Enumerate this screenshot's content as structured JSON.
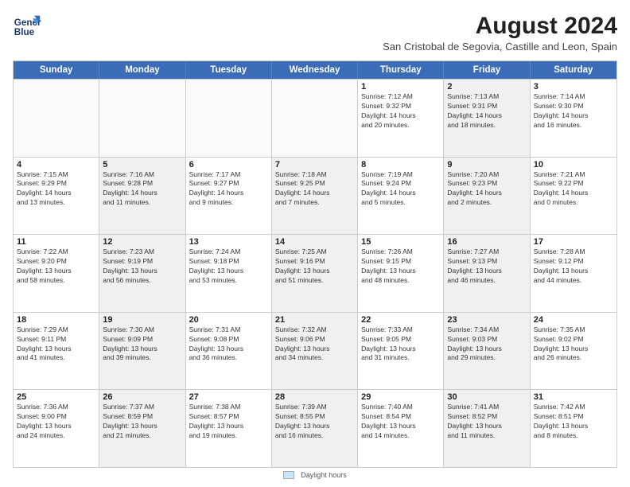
{
  "logo": {
    "line1": "General",
    "line2": "Blue"
  },
  "title": "August 2024",
  "subtitle": "San Cristobal de Segovia, Castille and Leon, Spain",
  "header_days": [
    "Sunday",
    "Monday",
    "Tuesday",
    "Wednesday",
    "Thursday",
    "Friday",
    "Saturday"
  ],
  "footer": {
    "legend_label": "Daylight hours"
  },
  "rows": [
    [
      {
        "num": "",
        "info": "",
        "empty": true
      },
      {
        "num": "",
        "info": "",
        "empty": true
      },
      {
        "num": "",
        "info": "",
        "empty": true
      },
      {
        "num": "",
        "info": "",
        "empty": true
      },
      {
        "num": "1",
        "info": "Sunrise: 7:12 AM\nSunset: 9:32 PM\nDaylight: 14 hours\nand 20 minutes.",
        "empty": false,
        "shaded": false
      },
      {
        "num": "2",
        "info": "Sunrise: 7:13 AM\nSunset: 9:31 PM\nDaylight: 14 hours\nand 18 minutes.",
        "empty": false,
        "shaded": true
      },
      {
        "num": "3",
        "info": "Sunrise: 7:14 AM\nSunset: 9:30 PM\nDaylight: 14 hours\nand 16 minutes.",
        "empty": false,
        "shaded": false
      }
    ],
    [
      {
        "num": "4",
        "info": "Sunrise: 7:15 AM\nSunset: 9:29 PM\nDaylight: 14 hours\nand 13 minutes.",
        "empty": false,
        "shaded": false
      },
      {
        "num": "5",
        "info": "Sunrise: 7:16 AM\nSunset: 9:28 PM\nDaylight: 14 hours\nand 11 minutes.",
        "empty": false,
        "shaded": true
      },
      {
        "num": "6",
        "info": "Sunrise: 7:17 AM\nSunset: 9:27 PM\nDaylight: 14 hours\nand 9 minutes.",
        "empty": false,
        "shaded": false
      },
      {
        "num": "7",
        "info": "Sunrise: 7:18 AM\nSunset: 9:25 PM\nDaylight: 14 hours\nand 7 minutes.",
        "empty": false,
        "shaded": true
      },
      {
        "num": "8",
        "info": "Sunrise: 7:19 AM\nSunset: 9:24 PM\nDaylight: 14 hours\nand 5 minutes.",
        "empty": false,
        "shaded": false
      },
      {
        "num": "9",
        "info": "Sunrise: 7:20 AM\nSunset: 9:23 PM\nDaylight: 14 hours\nand 2 minutes.",
        "empty": false,
        "shaded": true
      },
      {
        "num": "10",
        "info": "Sunrise: 7:21 AM\nSunset: 9:22 PM\nDaylight: 14 hours\nand 0 minutes.",
        "empty": false,
        "shaded": false
      }
    ],
    [
      {
        "num": "11",
        "info": "Sunrise: 7:22 AM\nSunset: 9:20 PM\nDaylight: 13 hours\nand 58 minutes.",
        "empty": false,
        "shaded": false
      },
      {
        "num": "12",
        "info": "Sunrise: 7:23 AM\nSunset: 9:19 PM\nDaylight: 13 hours\nand 56 minutes.",
        "empty": false,
        "shaded": true
      },
      {
        "num": "13",
        "info": "Sunrise: 7:24 AM\nSunset: 9:18 PM\nDaylight: 13 hours\nand 53 minutes.",
        "empty": false,
        "shaded": false
      },
      {
        "num": "14",
        "info": "Sunrise: 7:25 AM\nSunset: 9:16 PM\nDaylight: 13 hours\nand 51 minutes.",
        "empty": false,
        "shaded": true
      },
      {
        "num": "15",
        "info": "Sunrise: 7:26 AM\nSunset: 9:15 PM\nDaylight: 13 hours\nand 48 minutes.",
        "empty": false,
        "shaded": false
      },
      {
        "num": "16",
        "info": "Sunrise: 7:27 AM\nSunset: 9:13 PM\nDaylight: 13 hours\nand 46 minutes.",
        "empty": false,
        "shaded": true
      },
      {
        "num": "17",
        "info": "Sunrise: 7:28 AM\nSunset: 9:12 PM\nDaylight: 13 hours\nand 44 minutes.",
        "empty": false,
        "shaded": false
      }
    ],
    [
      {
        "num": "18",
        "info": "Sunrise: 7:29 AM\nSunset: 9:11 PM\nDaylight: 13 hours\nand 41 minutes.",
        "empty": false,
        "shaded": false
      },
      {
        "num": "19",
        "info": "Sunrise: 7:30 AM\nSunset: 9:09 PM\nDaylight: 13 hours\nand 39 minutes.",
        "empty": false,
        "shaded": true
      },
      {
        "num": "20",
        "info": "Sunrise: 7:31 AM\nSunset: 9:08 PM\nDaylight: 13 hours\nand 36 minutes.",
        "empty": false,
        "shaded": false
      },
      {
        "num": "21",
        "info": "Sunrise: 7:32 AM\nSunset: 9:06 PM\nDaylight: 13 hours\nand 34 minutes.",
        "empty": false,
        "shaded": true
      },
      {
        "num": "22",
        "info": "Sunrise: 7:33 AM\nSunset: 9:05 PM\nDaylight: 13 hours\nand 31 minutes.",
        "empty": false,
        "shaded": false
      },
      {
        "num": "23",
        "info": "Sunrise: 7:34 AM\nSunset: 9:03 PM\nDaylight: 13 hours\nand 29 minutes.",
        "empty": false,
        "shaded": true
      },
      {
        "num": "24",
        "info": "Sunrise: 7:35 AM\nSunset: 9:02 PM\nDaylight: 13 hours\nand 26 minutes.",
        "empty": false,
        "shaded": false
      }
    ],
    [
      {
        "num": "25",
        "info": "Sunrise: 7:36 AM\nSunset: 9:00 PM\nDaylight: 13 hours\nand 24 minutes.",
        "empty": false,
        "shaded": false
      },
      {
        "num": "26",
        "info": "Sunrise: 7:37 AM\nSunset: 8:59 PM\nDaylight: 13 hours\nand 21 minutes.",
        "empty": false,
        "shaded": true
      },
      {
        "num": "27",
        "info": "Sunrise: 7:38 AM\nSunset: 8:57 PM\nDaylight: 13 hours\nand 19 minutes.",
        "empty": false,
        "shaded": false
      },
      {
        "num": "28",
        "info": "Sunrise: 7:39 AM\nSunset: 8:55 PM\nDaylight: 13 hours\nand 16 minutes.",
        "empty": false,
        "shaded": true
      },
      {
        "num": "29",
        "info": "Sunrise: 7:40 AM\nSunset: 8:54 PM\nDaylight: 13 hours\nand 14 minutes.",
        "empty": false,
        "shaded": false
      },
      {
        "num": "30",
        "info": "Sunrise: 7:41 AM\nSunset: 8:52 PM\nDaylight: 13 hours\nand 11 minutes.",
        "empty": false,
        "shaded": true
      },
      {
        "num": "31",
        "info": "Sunrise: 7:42 AM\nSunset: 8:51 PM\nDaylight: 13 hours\nand 8 minutes.",
        "empty": false,
        "shaded": false
      }
    ]
  ]
}
